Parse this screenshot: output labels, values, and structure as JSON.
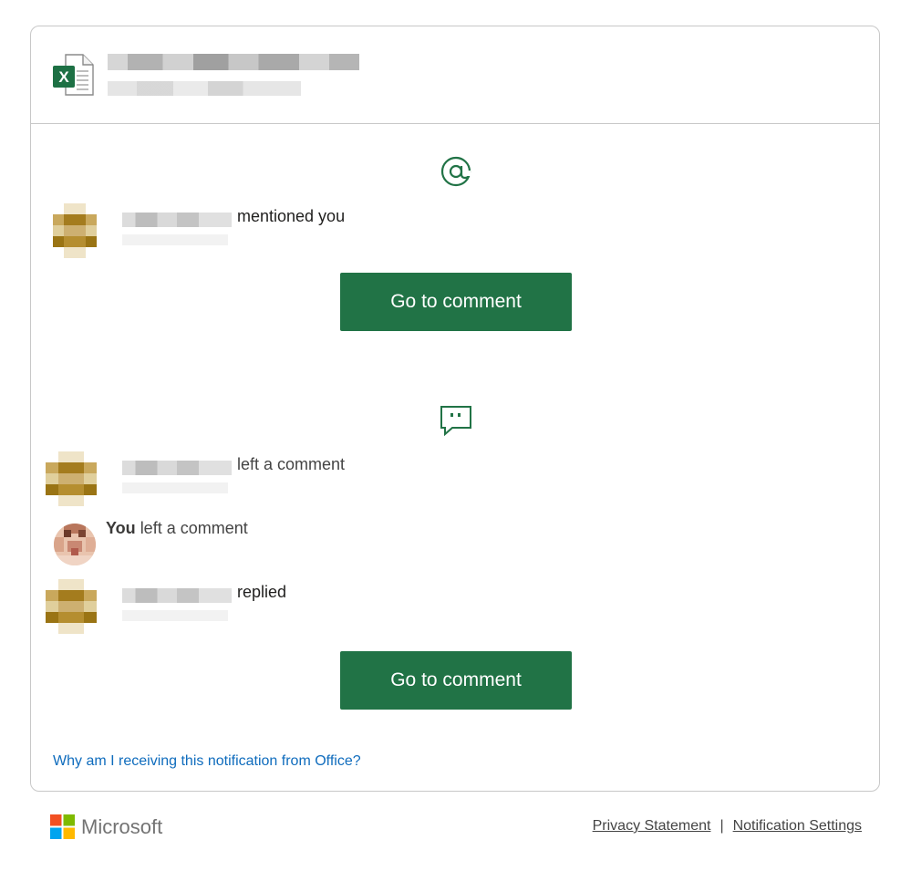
{
  "header": {
    "file_icon_letter": "X",
    "file_icon": "excel-file-icon"
  },
  "mention_section": {
    "icon": "at-sign-icon",
    "row_text": "mentioned you",
    "button_label": "Go to comment"
  },
  "comment_section": {
    "icon": "comment-bubble-icon",
    "rows": [
      {
        "text": "left a comment"
      },
      {
        "bold": "You",
        "text": "left a comment"
      },
      {
        "text": "replied"
      }
    ],
    "button_label": "Go to comment"
  },
  "why_link": "Why am I receiving this notification from Office?",
  "footer": {
    "brand": "Microsoft",
    "privacy": "Privacy Statement",
    "separator": "|",
    "settings": "Notification Settings"
  },
  "colors": {
    "accent_green": "#217346",
    "link_blue": "#0f6cbd"
  }
}
